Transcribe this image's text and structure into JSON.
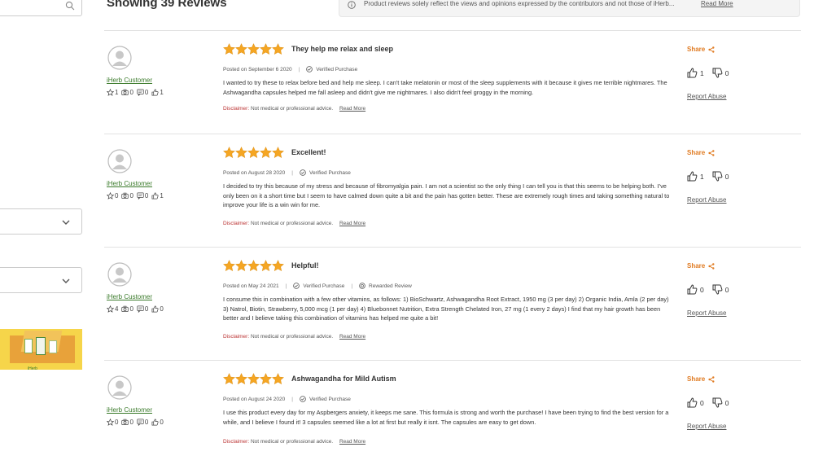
{
  "sidebar": {
    "banner_brand": "iHerb"
  },
  "header": {
    "heading": "Showing 39 Reviews",
    "notice_text": "Product reviews solely reflect the views and opinions expressed by the contributors and not those of iHerb...",
    "notice_link": "Read More"
  },
  "colors": {
    "star": "#f5a623",
    "accent_orange": "#e07b22",
    "author_green": "#3a7a2a",
    "disclaimer_red": "#b33333"
  },
  "reviews": [
    {
      "rating": 5,
      "title": "They help me relax and sleep",
      "posted": "Posted on September 6 2020",
      "badge": "Verified Purchase",
      "extra_badge": "",
      "body": "I wanted to try these to relax before bed and help me sleep. I can't take melatonin or most of the sleep supplements with it because it gives me terrible nightmares. The Ashwagandha capsules helped me fall asleep and didn't give me nightmares. I also didn't feel groggy in the morning.",
      "author": "iHerb Customer",
      "author_stats": [
        "1",
        "0",
        "0",
        "1"
      ],
      "share": "Share",
      "helpful": "1",
      "not_helpful": "0",
      "report": "Report Abuse",
      "disclaimer_label": "Disclaimer:",
      "disclaimer_text": "Not medical or professional advice.",
      "read_more": "Read More"
    },
    {
      "rating": 5,
      "title": "Excellent!",
      "posted": "Posted on August 28 2020",
      "badge": "Verified Purchase",
      "extra_badge": "",
      "body": "I decided to try this because of my stress and because of fibromyalgia pain. I am not a scientist so the only thing I can tell you is that this seems to be helping both. I've only been on it a short time but I seem to have calmed down quite a bit and the pain has gotten better. These are extremely rough times and taking something natural to improve your life is a win win for me.",
      "author": "iHerb Customer",
      "author_stats": [
        "0",
        "0",
        "0",
        "1"
      ],
      "share": "Share",
      "helpful": "1",
      "not_helpful": "0",
      "report": "Report Abuse",
      "disclaimer_label": "Disclaimer:",
      "disclaimer_text": "Not medical or professional advice.",
      "read_more": "Read More"
    },
    {
      "rating": 5,
      "title": "Helpful!",
      "posted": "Posted on May 24 2021",
      "badge": "Verified Purchase",
      "extra_badge": "Rewarded Review",
      "body": "I consume this in combination with a few other vitamins, as follows: 1) BioSchwartz, Ashwagandha Root Extract, 1950 mg (3 per day) 2) Organic India, Amla (2 per day) 3) Natrol, Biotin, Strawberry, 5,000 mcg (1 per day) 4) Bluebonnet Nutrition, Extra Strength Chelated Iron, 27 mg (1 every 2 days) I find that my hair growth has been better and I believe taking this combination of vitamins has helped me quite a bit!",
      "author": "iHerb Customer",
      "author_stats": [
        "4",
        "0",
        "0",
        "0"
      ],
      "share": "Share",
      "helpful": "0",
      "not_helpful": "0",
      "report": "Report Abuse",
      "disclaimer_label": "Disclaimer:",
      "disclaimer_text": "Not medical or professional advice.",
      "read_more": "Read More"
    },
    {
      "rating": 5,
      "title": "Ashwagandha for Mild Autism",
      "posted": "Posted on August 24 2020",
      "badge": "Verified Purchase",
      "extra_badge": "",
      "body": "I use this product every day for my Aspbergers anxiety, it keeps me sane. This formula is strong and worth the purchase! I have been trying to find the best version for a while, and I believe I found it! 3 capsules seemed like a lot at first but really it isnt. The capsules are easy to get down.",
      "author": "iHerb Customer",
      "author_stats": [
        "0",
        "0",
        "0",
        "0"
      ],
      "share": "Share",
      "helpful": "0",
      "not_helpful": "0",
      "report": "Report Abuse",
      "disclaimer_label": "Disclaimer:",
      "disclaimer_text": "Not medical or professional advice.",
      "read_more": "Read More"
    }
  ]
}
